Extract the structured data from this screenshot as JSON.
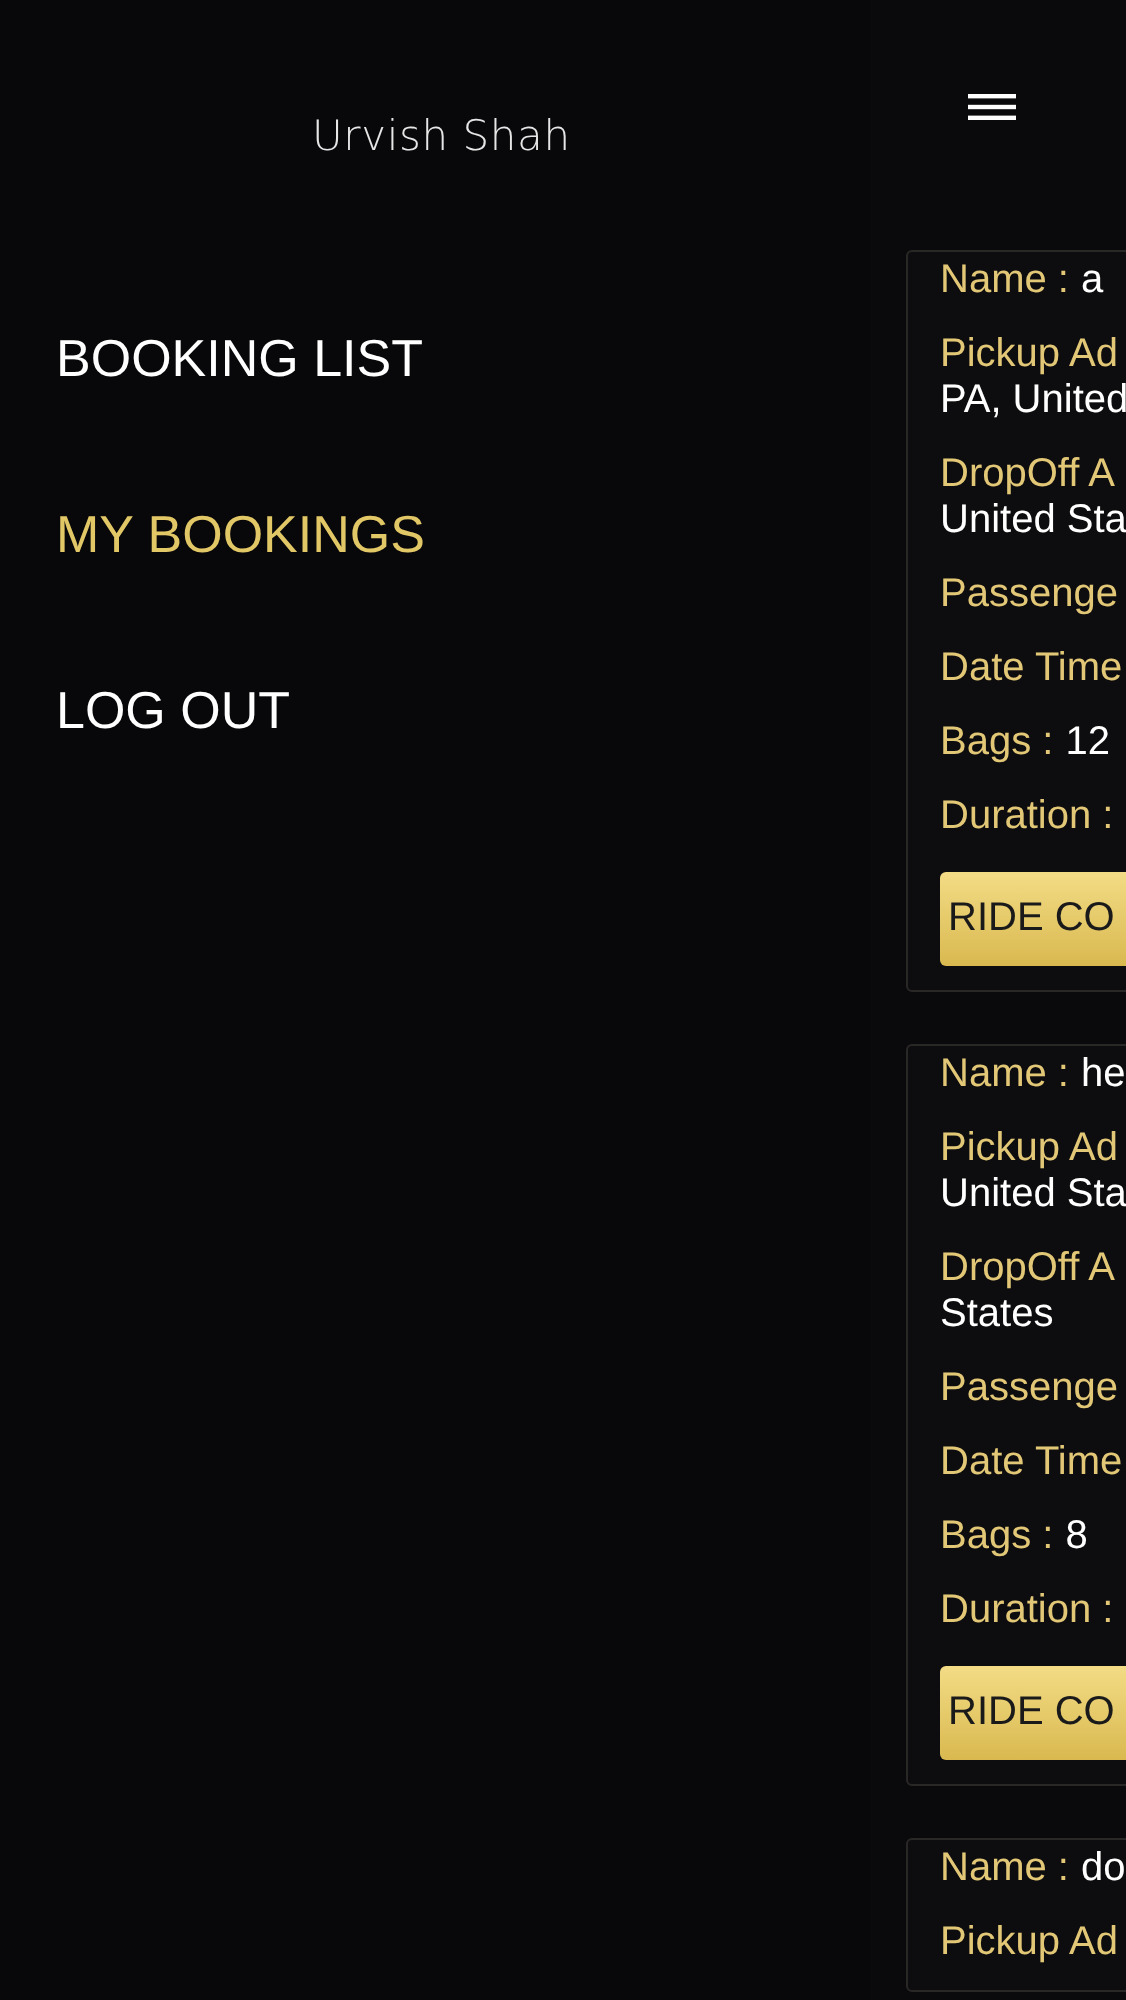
{
  "drawer": {
    "user_name": "Urvish Shah",
    "items": [
      {
        "label": "BOOKING LIST",
        "selected": false
      },
      {
        "label": "MY BOOKINGS",
        "selected": true
      },
      {
        "label": "LOG OUT",
        "selected": false
      }
    ]
  },
  "bookings": [
    {
      "rows": [
        {
          "label": "Name :",
          "value": "a"
        },
        {
          "label": "Pickup Ad",
          "value": "PA, United",
          "kind": "stacked"
        },
        {
          "label": "DropOff A",
          "value": "United Sta",
          "kind": "stacked"
        },
        {
          "label": "Passenge"
        },
        {
          "label": "Date Time"
        },
        {
          "label": "Bags :",
          "value": "12"
        },
        {
          "label": "Duration :"
        }
      ],
      "button": "RIDE CO"
    },
    {
      "rows": [
        {
          "label": "Name :",
          "value": "he"
        },
        {
          "label": "Pickup Ad",
          "value": "United Sta",
          "kind": "stacked"
        },
        {
          "label": "DropOff A",
          "value": "States",
          "kind": "stacked"
        },
        {
          "label": "Passenge"
        },
        {
          "label": "Date Time"
        },
        {
          "label": "Bags :",
          "value": "8"
        },
        {
          "label": "Duration :"
        }
      ],
      "button": "RIDE CO"
    },
    {
      "rows": [
        {
          "label": "Name :",
          "value": "do"
        },
        {
          "label": "Pickup Ad"
        }
      ]
    }
  ]
}
